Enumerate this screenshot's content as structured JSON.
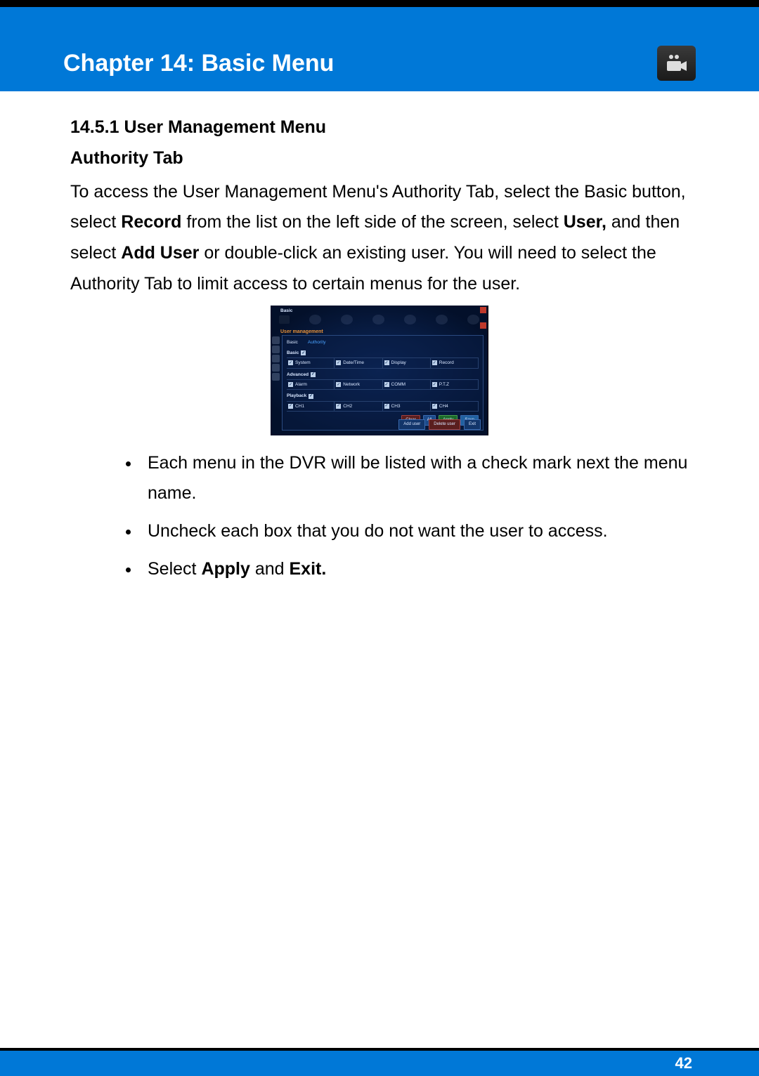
{
  "header": {
    "chapter_title": "Chapter 14: Basic Menu"
  },
  "section": {
    "number": "14.5.1 User Management Menu",
    "subtitle": "Authority Tab",
    "para_parts": {
      "p1": "To access the User Management Menu's Authority Tab, select the Basic button, select ",
      "p2": "Record",
      "p3": " from the list on the left side of the screen, select ",
      "p4": "User,",
      "p5": " and then select ",
      "p6": "Add User",
      "p7": " or double-click an existing user. You will need to select the Authority Tab to limit access to certain menus for the user."
    }
  },
  "bullets": {
    "b1": "Each menu in the DVR will be listed with a check mark next the menu name.",
    "b2": "Uncheck each box that you do not want the user to access.",
    "b3_pre": "Select ",
    "b3_bold1": "Apply",
    "b3_mid": " and ",
    "b3_bold2": "Exit."
  },
  "dvr": {
    "window_title": "Basic",
    "breadcrumb": "User management",
    "tabs": {
      "basic": "Basic",
      "authority": "Authority"
    },
    "groups": {
      "basic": "Basic",
      "advanced": "Advanced",
      "playback": "Playback"
    },
    "cells": {
      "system": "System",
      "datetime": "Date/Time",
      "display": "Display",
      "record": "Record",
      "alarm": "Alarm",
      "network": "Network",
      "comm": "COMM",
      "ptz": "P.T.Z",
      "ch1": "CH1",
      "ch2": "CH2",
      "ch3": "CH3",
      "ch4": "CH4"
    },
    "buttons": {
      "clear": "Clear",
      "all": "All",
      "apply": "Apply",
      "save": "Save",
      "add_user": "Add user",
      "delete_user": "Delete user",
      "exit": "Exit"
    }
  },
  "footer": {
    "page_number": "42"
  }
}
